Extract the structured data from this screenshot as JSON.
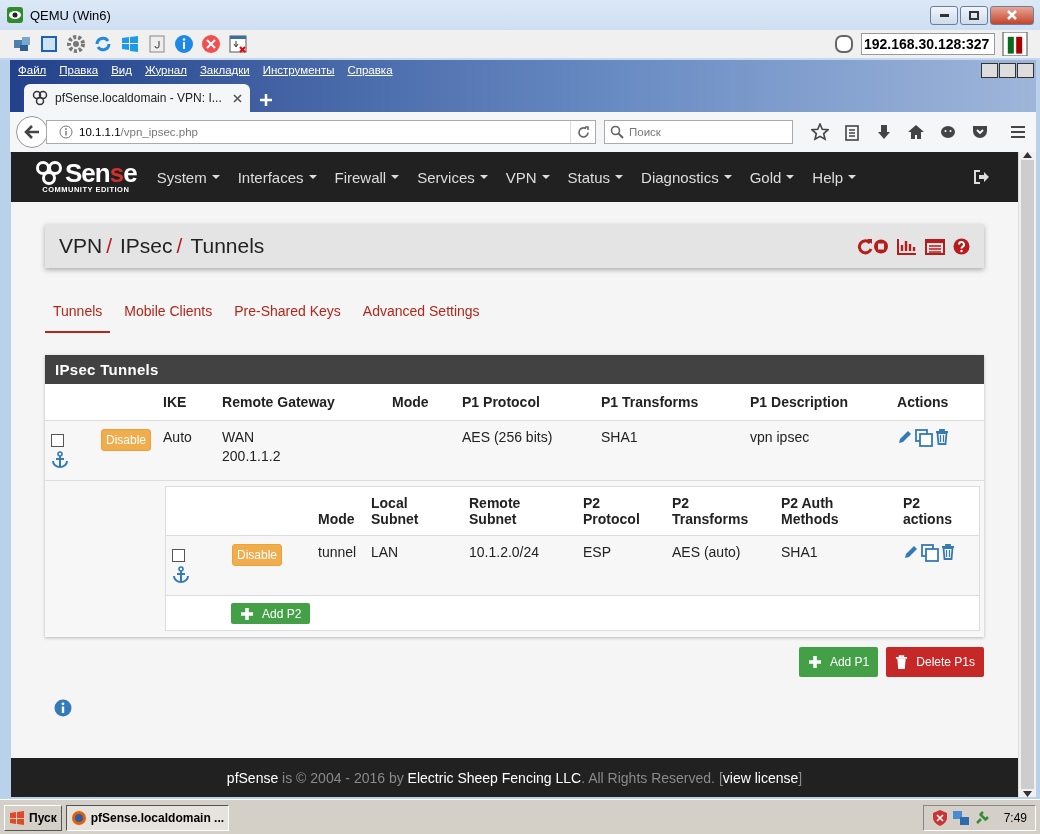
{
  "qemu": {
    "title": "QEMU (Win6)",
    "address": "192.168.30.128:327"
  },
  "firefox": {
    "menu": [
      "Файл",
      "Правка",
      "Вид",
      "Журнал",
      "Закладки",
      "Инструменты",
      "Справка"
    ],
    "tabs": [
      {
        "title": "pfSense.localdomain - VPN: I...",
        "selected": true
      }
    ],
    "url_host": "10.1.1.1",
    "url_path": "/vpn_ipsec.php",
    "search": {
      "placeholder": "Поиск"
    }
  },
  "page": {
    "logo": {
      "text": "Sen**s**e",
      "subtitle": "COMMUNITY EDITION"
    },
    "nav": [
      "System",
      "Interfaces",
      "Firewall",
      "Services",
      "VPN",
      "Status",
      "Diagnostics",
      "Gold",
      "Help"
    ],
    "breadcrumb": {
      "items": [
        "VPN",
        "IPsec",
        "Tunnels"
      ],
      "separator": "/"
    },
    "subtabs": [
      {
        "label": "Tunnels",
        "selected": true
      },
      {
        "label": "Mobile Clients",
        "selected": false
      },
      {
        "label": "Pre-Shared Keys",
        "selected": false
      },
      {
        "label": "Advanced Settings",
        "selected": false
      }
    ],
    "panel": {
      "title": "IPsec Tunnels",
      "columns": [
        "IKE",
        "Remote Gateway",
        "Mode",
        "P1 Protocol",
        "P1 Transforms",
        "P1 Description",
        "Actions"
      ],
      "rows": [
        {
          "checked": false,
          "button": "Disable",
          "ike": "Auto",
          "remote_gateway": [
            "WAN",
            "200.1.1.2"
          ],
          "p1_protocol": "AES (256 bits)",
          "p1_transforms": "SHA1",
          "p1_description": "vpn ipsec",
          "phase2": {
            "columns": [
              "Mode",
              "Local Subnet",
              "Remote Subnet",
              "P2 Protocol",
              "P2 Transforms",
              "P2 Auth Methods",
              "P2 actions"
            ],
            "rows": [
              {
                "checked": false,
                "button": "Disable",
                "mode": "tunnel",
                "local_subnet": "LAN",
                "remote_subnet": "10.1.2.0/24",
                "p2_protocol": "ESP",
                "p2_transforms": "AES (auto)",
                "p2_auth_methods": "SHA1"
              }
            ],
            "add_button": "Add P2"
          }
        }
      ]
    },
    "buttons": [
      {
        "kind": "add",
        "label": "Add P1"
      },
      {
        "kind": "delete",
        "label": "Delete P1s"
      }
    ],
    "footer": {
      "text": "**pfSense** is © 2004 - 2016 by **Electric Sheep Fencing LLC**. All Rights Reserved. [",
      "link": "view license",
      "suffix": "]"
    }
  },
  "taskbar": {
    "start": "Пуск",
    "tasks": [
      {
        "title": "pfSense.localdomain ...",
        "selected": true
      }
    ],
    "clock": "7:49"
  }
}
